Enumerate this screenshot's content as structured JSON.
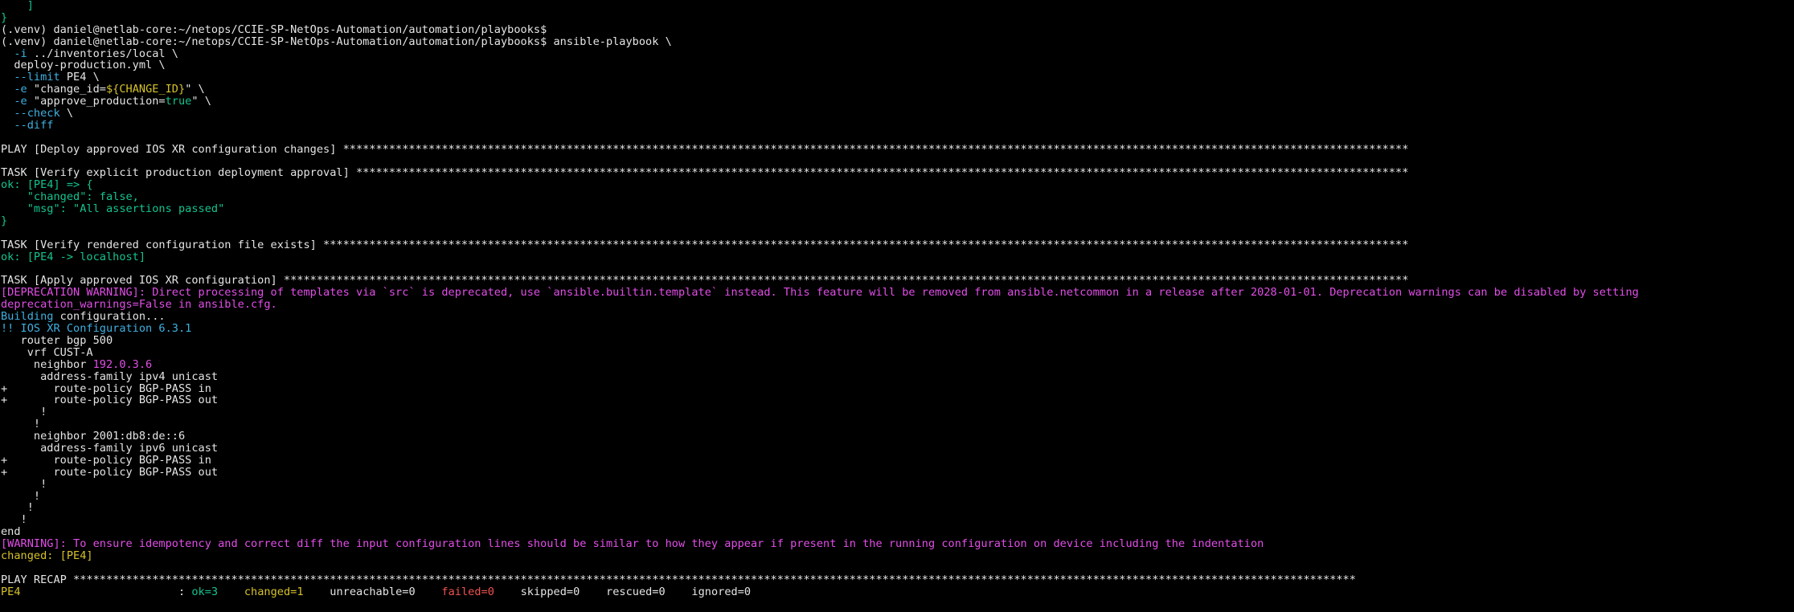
{
  "terminal": {
    "lines": [
      [
        [
          "    ]",
          "green"
        ]
      ],
      [
        [
          "}",
          "green"
        ]
      ],
      [
        [
          "(.venv) daniel@netlab-core:~/netops/CCIE-SP-NetOps-Automation/automation/playbooks$",
          "white"
        ]
      ],
      [
        [
          "(.venv) daniel@netlab-core:~/netops/CCIE-SP-NetOps-Automation/automation/playbooks$ ansible-playbook \\",
          "white"
        ]
      ],
      [
        [
          "  -i",
          "cyan"
        ],
        [
          " ../inventories/local \\",
          "white"
        ]
      ],
      [
        [
          "  deploy-production.yml \\",
          "white"
        ]
      ],
      [
        [
          "  --limit",
          "cyan"
        ],
        [
          " PE4 \\",
          "white"
        ]
      ],
      [
        [
          "  -e",
          "cyan"
        ],
        [
          " \"change_id=",
          "white"
        ],
        [
          "${CHANGE_ID}",
          "yellow"
        ],
        [
          "\" \\",
          "white"
        ]
      ],
      [
        [
          "  -e",
          "cyan"
        ],
        [
          " \"approve_production=",
          "white"
        ],
        [
          "true",
          "green"
        ],
        [
          "\" \\",
          "white"
        ]
      ],
      [
        [
          "  --check",
          "cyan"
        ],
        [
          " \\",
          "white"
        ]
      ],
      [
        [
          "  --diff",
          "cyan"
        ]
      ],
      [
        [
          "",
          "white"
        ]
      ],
      [
        [
          "PLAY [Deploy approved IOS XR configuration changes] ******************************************************************************************************************************************************************",
          "white"
        ]
      ],
      [
        [
          "",
          "white"
        ]
      ],
      [
        [
          "TASK [Verify explicit production deployment approval] ****************************************************************************************************************************************************************",
          "white"
        ]
      ],
      [
        [
          "ok: [PE4] => {",
          "green"
        ]
      ],
      [
        [
          "    \"changed\": false,",
          "green"
        ]
      ],
      [
        [
          "    \"msg\": \"All assertions passed\"",
          "green"
        ]
      ],
      [
        [
          "}",
          "green"
        ]
      ],
      [
        [
          "",
          "white"
        ]
      ],
      [
        [
          "TASK [Verify rendered configuration file exists] *********************************************************************************************************************************************************************",
          "white"
        ]
      ],
      [
        [
          "ok: [PE4 -> localhost]",
          "green"
        ]
      ],
      [
        [
          "",
          "white"
        ]
      ],
      [
        [
          "TASK [Apply approved IOS XR configuration] ***************************************************************************************************************************************************************************",
          "white"
        ]
      ],
      [
        [
          "[DEPRECATION WARNING]: Direct processing of templates via `src` is deprecated, use `ansible.builtin.template` instead. This feature will be removed from ansible.netcommon in a release after 2028-01-01. Deprecation warnings can be disabled by setting",
          "magenta"
        ]
      ],
      [
        [
          "deprecation_warnings=False in ansible.cfg.",
          "magenta"
        ]
      ],
      [
        [
          "Building",
          "cyan"
        ],
        [
          " configuration...",
          "white"
        ]
      ],
      [
        [
          "!! IOS XR Configuration 6.3.1",
          "cyan"
        ]
      ],
      [
        [
          "   router bgp 500",
          "white"
        ]
      ],
      [
        [
          "    vrf CUST-A",
          "white"
        ]
      ],
      [
        [
          "     neighbor ",
          "white"
        ],
        [
          "192.0.3.6",
          "magenta"
        ]
      ],
      [
        [
          "      address-family ipv4 unicast",
          "white"
        ]
      ],
      [
        [
          "+       route-policy BGP-PASS in",
          "white"
        ]
      ],
      [
        [
          "+       route-policy BGP-PASS out",
          "white"
        ]
      ],
      [
        [
          "      !",
          "white"
        ]
      ],
      [
        [
          "     !",
          "white"
        ]
      ],
      [
        [
          "     neighbor 2001:db8:de::6",
          "white"
        ]
      ],
      [
        [
          "      address-family ipv6 unicast",
          "white"
        ]
      ],
      [
        [
          "+       route-policy BGP-PASS in",
          "white"
        ]
      ],
      [
        [
          "+       route-policy BGP-PASS out",
          "white"
        ]
      ],
      [
        [
          "      !",
          "white"
        ]
      ],
      [
        [
          "     !",
          "white"
        ]
      ],
      [
        [
          "    !",
          "white"
        ]
      ],
      [
        [
          "   !",
          "white"
        ]
      ],
      [
        [
          "end",
          "white"
        ]
      ],
      [
        [
          "[WARNING]: To ensure idempotency and correct diff the input configuration lines should be similar to how they appear if present in the running configuration on device including the indentation",
          "magenta"
        ]
      ],
      [
        [
          "changed: [PE4]",
          "yellow"
        ]
      ],
      [
        [
          "",
          "white"
        ]
      ],
      [
        [
          "PLAY RECAP ***************************************************************************************************************************************************************************************************",
          "white"
        ]
      ],
      [
        [
          "PE4",
          "yellow"
        ],
        [
          "                        : ",
          "white"
        ],
        [
          "ok=3",
          "green"
        ],
        [
          "    ",
          "white"
        ],
        [
          "changed=1",
          "yellow"
        ],
        [
          "    unreachable=0    ",
          "white"
        ],
        [
          "failed=0",
          "red"
        ],
        [
          "    skipped=0    rescued=0    ignored=0",
          "white"
        ]
      ]
    ]
  }
}
